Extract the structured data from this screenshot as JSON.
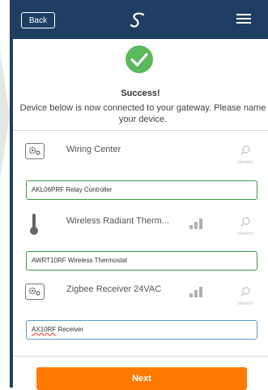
{
  "header": {
    "back_label": "Back",
    "logo_icon": "s-logo-icon",
    "menu_icon": "hamburger-menu-icon"
  },
  "status": {
    "icon": "checkmark-circle-icon",
    "title": "Success!",
    "message": "Device below is now connected to your gateway. Please name your device."
  },
  "devices": [
    {
      "name": "Wiring Center",
      "icon": "gear-box-icon",
      "signal": false,
      "identify_label": "Identify",
      "field_value": "AKL06PRF Relay Controller"
    },
    {
      "name": "Wireless Radiant Therm...",
      "icon": "thermometer-icon",
      "signal": true,
      "identify_label": "Identify",
      "field_value": "AWRT10RF Wireless Thermostat"
    },
    {
      "name": "Zigbee Receiver 24VAC",
      "icon": "gear-box-icon",
      "signal": true,
      "identify_label": "Identify",
      "field_value_main": "AX10RF",
      "field_value_rest": " Receiver"
    }
  ],
  "footer": {
    "next_label": "Next"
  },
  "colors": {
    "header": "#1e3f63",
    "accent": "#ff7a00",
    "success": "#5cb85c",
    "field_border": "#3d9a45"
  }
}
